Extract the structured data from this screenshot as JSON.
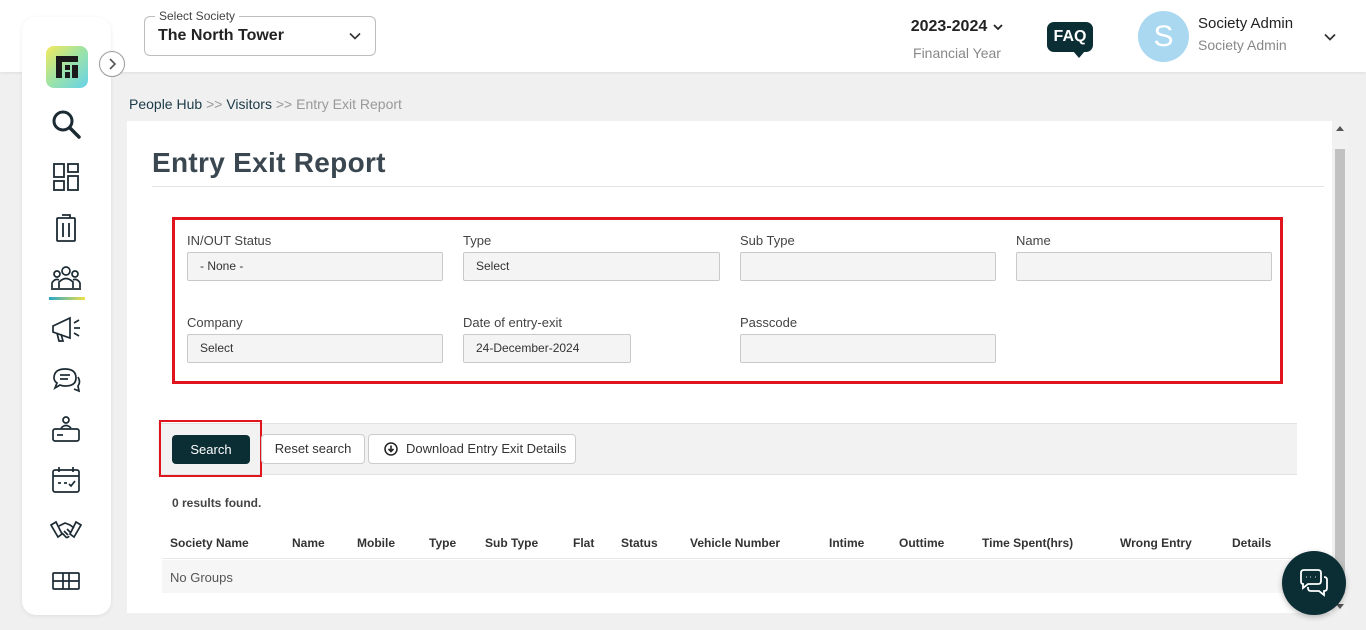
{
  "header": {
    "society_select": {
      "label": "Select Society",
      "value": "The North Tower"
    },
    "financial_year": {
      "value": "2023-2024",
      "label": "Financial Year"
    },
    "faq_label": "FAQ",
    "user": {
      "avatar_initial": "S",
      "name": "Society Admin",
      "role": "Society Admin"
    }
  },
  "sidebar": {
    "items": [
      {
        "icon": "search-icon"
      },
      {
        "icon": "dashboard-icon"
      },
      {
        "icon": "building-icon"
      },
      {
        "icon": "people-icon",
        "active": true
      },
      {
        "icon": "megaphone-icon"
      },
      {
        "icon": "chat-icon"
      },
      {
        "icon": "helpdesk-icon"
      },
      {
        "icon": "calendar-icon"
      },
      {
        "icon": "handshake-icon"
      },
      {
        "icon": "package-icon"
      }
    ]
  },
  "breadcrumb": {
    "items": [
      "People Hub",
      "Visitors",
      "Entry Exit Report"
    ],
    "separator": ">>"
  },
  "page": {
    "title": "Entry Exit Report"
  },
  "filters": {
    "in_out_status": {
      "label": "IN/OUT Status",
      "value": "- None -"
    },
    "type": {
      "label": "Type",
      "value": "Select"
    },
    "sub_type": {
      "label": "Sub Type",
      "value": ""
    },
    "name": {
      "label": "Name",
      "value": ""
    },
    "company": {
      "label": "Company",
      "value": "Select"
    },
    "date": {
      "label": "Date of entry-exit",
      "value": "24-December-2024"
    },
    "passcode": {
      "label": "Passcode",
      "value": ""
    }
  },
  "actions": {
    "search": "Search",
    "reset": "Reset search",
    "download": "Download Entry Exit Details"
  },
  "results": {
    "summary": "0 results found.",
    "columns": [
      "Society Name",
      "Name",
      "Mobile",
      "Type",
      "Sub Type",
      "Flat",
      "Status",
      "Vehicle Number",
      "Intime",
      "Outtime",
      "Time Spent(hrs)",
      "Wrong Entry",
      "Details"
    ],
    "empty_message": "No Groups"
  },
  "colors": {
    "brand_dark": "#0b2e35",
    "highlight_red": "#e0141c",
    "avatar_bg": "#a9d8f0"
  }
}
